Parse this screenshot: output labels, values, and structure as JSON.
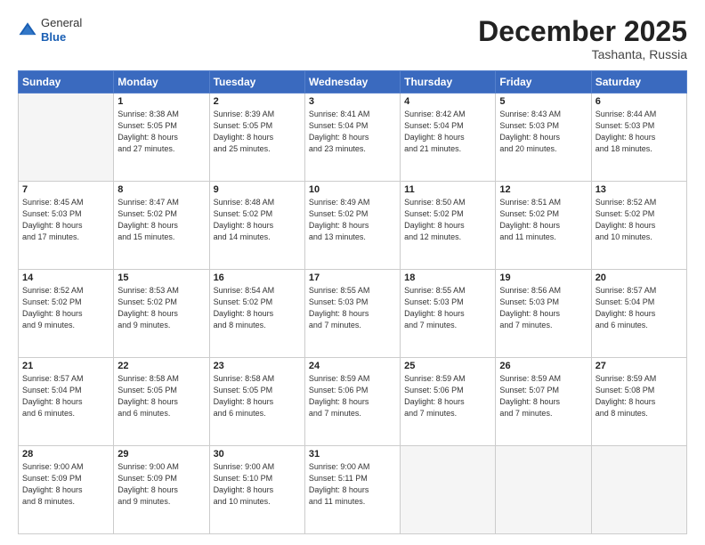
{
  "header": {
    "logo_general": "General",
    "logo_blue": "Blue",
    "month": "December 2025",
    "location": "Tashanta, Russia"
  },
  "weekdays": [
    "Sunday",
    "Monday",
    "Tuesday",
    "Wednesday",
    "Thursday",
    "Friday",
    "Saturday"
  ],
  "weeks": [
    [
      {
        "num": "",
        "info": ""
      },
      {
        "num": "1",
        "info": "Sunrise: 8:38 AM\nSunset: 5:05 PM\nDaylight: 8 hours\nand 27 minutes."
      },
      {
        "num": "2",
        "info": "Sunrise: 8:39 AM\nSunset: 5:05 PM\nDaylight: 8 hours\nand 25 minutes."
      },
      {
        "num": "3",
        "info": "Sunrise: 8:41 AM\nSunset: 5:04 PM\nDaylight: 8 hours\nand 23 minutes."
      },
      {
        "num": "4",
        "info": "Sunrise: 8:42 AM\nSunset: 5:04 PM\nDaylight: 8 hours\nand 21 minutes."
      },
      {
        "num": "5",
        "info": "Sunrise: 8:43 AM\nSunset: 5:03 PM\nDaylight: 8 hours\nand 20 minutes."
      },
      {
        "num": "6",
        "info": "Sunrise: 8:44 AM\nSunset: 5:03 PM\nDaylight: 8 hours\nand 18 minutes."
      }
    ],
    [
      {
        "num": "7",
        "info": "Sunrise: 8:45 AM\nSunset: 5:03 PM\nDaylight: 8 hours\nand 17 minutes."
      },
      {
        "num": "8",
        "info": "Sunrise: 8:47 AM\nSunset: 5:02 PM\nDaylight: 8 hours\nand 15 minutes."
      },
      {
        "num": "9",
        "info": "Sunrise: 8:48 AM\nSunset: 5:02 PM\nDaylight: 8 hours\nand 14 minutes."
      },
      {
        "num": "10",
        "info": "Sunrise: 8:49 AM\nSunset: 5:02 PM\nDaylight: 8 hours\nand 13 minutes."
      },
      {
        "num": "11",
        "info": "Sunrise: 8:50 AM\nSunset: 5:02 PM\nDaylight: 8 hours\nand 12 minutes."
      },
      {
        "num": "12",
        "info": "Sunrise: 8:51 AM\nSunset: 5:02 PM\nDaylight: 8 hours\nand 11 minutes."
      },
      {
        "num": "13",
        "info": "Sunrise: 8:52 AM\nSunset: 5:02 PM\nDaylight: 8 hours\nand 10 minutes."
      }
    ],
    [
      {
        "num": "14",
        "info": "Sunrise: 8:52 AM\nSunset: 5:02 PM\nDaylight: 8 hours\nand 9 minutes."
      },
      {
        "num": "15",
        "info": "Sunrise: 8:53 AM\nSunset: 5:02 PM\nDaylight: 8 hours\nand 9 minutes."
      },
      {
        "num": "16",
        "info": "Sunrise: 8:54 AM\nSunset: 5:02 PM\nDaylight: 8 hours\nand 8 minutes."
      },
      {
        "num": "17",
        "info": "Sunrise: 8:55 AM\nSunset: 5:03 PM\nDaylight: 8 hours\nand 7 minutes."
      },
      {
        "num": "18",
        "info": "Sunrise: 8:55 AM\nSunset: 5:03 PM\nDaylight: 8 hours\nand 7 minutes."
      },
      {
        "num": "19",
        "info": "Sunrise: 8:56 AM\nSunset: 5:03 PM\nDaylight: 8 hours\nand 7 minutes."
      },
      {
        "num": "20",
        "info": "Sunrise: 8:57 AM\nSunset: 5:04 PM\nDaylight: 8 hours\nand 6 minutes."
      }
    ],
    [
      {
        "num": "21",
        "info": "Sunrise: 8:57 AM\nSunset: 5:04 PM\nDaylight: 8 hours\nand 6 minutes."
      },
      {
        "num": "22",
        "info": "Sunrise: 8:58 AM\nSunset: 5:05 PM\nDaylight: 8 hours\nand 6 minutes."
      },
      {
        "num": "23",
        "info": "Sunrise: 8:58 AM\nSunset: 5:05 PM\nDaylight: 8 hours\nand 6 minutes."
      },
      {
        "num": "24",
        "info": "Sunrise: 8:59 AM\nSunset: 5:06 PM\nDaylight: 8 hours\nand 7 minutes."
      },
      {
        "num": "25",
        "info": "Sunrise: 8:59 AM\nSunset: 5:06 PM\nDaylight: 8 hours\nand 7 minutes."
      },
      {
        "num": "26",
        "info": "Sunrise: 8:59 AM\nSunset: 5:07 PM\nDaylight: 8 hours\nand 7 minutes."
      },
      {
        "num": "27",
        "info": "Sunrise: 8:59 AM\nSunset: 5:08 PM\nDaylight: 8 hours\nand 8 minutes."
      }
    ],
    [
      {
        "num": "28",
        "info": "Sunrise: 9:00 AM\nSunset: 5:09 PM\nDaylight: 8 hours\nand 8 minutes."
      },
      {
        "num": "29",
        "info": "Sunrise: 9:00 AM\nSunset: 5:09 PM\nDaylight: 8 hours\nand 9 minutes."
      },
      {
        "num": "30",
        "info": "Sunrise: 9:00 AM\nSunset: 5:10 PM\nDaylight: 8 hours\nand 10 minutes."
      },
      {
        "num": "31",
        "info": "Sunrise: 9:00 AM\nSunset: 5:11 PM\nDaylight: 8 hours\nand 11 minutes."
      },
      {
        "num": "",
        "info": ""
      },
      {
        "num": "",
        "info": ""
      },
      {
        "num": "",
        "info": ""
      }
    ]
  ]
}
